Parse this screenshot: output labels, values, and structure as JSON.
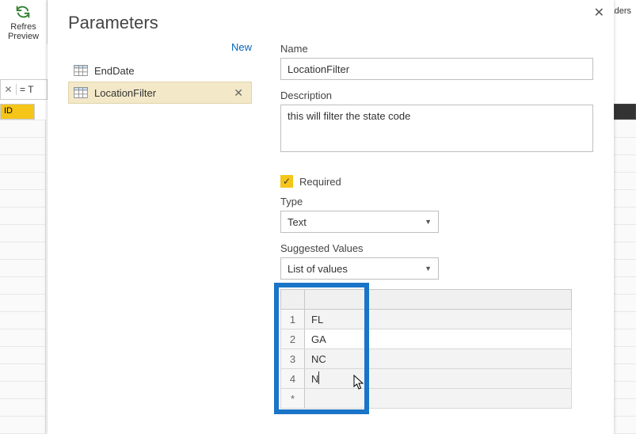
{
  "bg": {
    "refresh": "Refres\nPreview",
    "headers": "leaders",
    "id_col": "ID",
    "formula_eq": "= T"
  },
  "dialog": {
    "title": "Parameters",
    "new_link": "New"
  },
  "param_list": [
    {
      "label": "EndDate",
      "selected": false
    },
    {
      "label": "LocationFilter",
      "selected": true
    }
  ],
  "form": {
    "name_label": "Name",
    "name_value": "LocationFilter",
    "desc_label": "Description",
    "desc_value": "this will filter the state code",
    "required_label": "Required",
    "required_checked": true,
    "type_label": "Type",
    "type_value": "Text",
    "suggested_label": "Suggested Values",
    "suggested_value": "List of values"
  },
  "values": {
    "rows": [
      {
        "n": "1",
        "v": "FL"
      },
      {
        "n": "2",
        "v": "GA"
      },
      {
        "n": "3",
        "v": "NC"
      },
      {
        "n": "4",
        "v": "N"
      },
      {
        "n": "*",
        "v": ""
      }
    ]
  }
}
